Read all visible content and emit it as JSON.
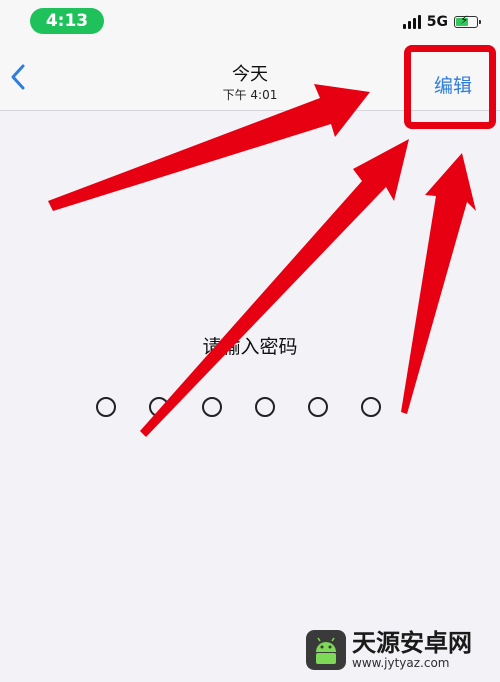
{
  "status_bar": {
    "time": "4:13",
    "network": "5G",
    "time_pill_color": "#1fc15a",
    "battery_color": "#34c759",
    "battery_level": 0.55,
    "icons": [
      "signal-icon",
      "battery-charging-icon"
    ]
  },
  "nav": {
    "back_icon": "chevron-left-icon",
    "title": "今天",
    "subtitle": "下午 4:01",
    "edit_label": "编辑",
    "accent_color": "#2f7ddc"
  },
  "passcode": {
    "prompt": "请输入密码",
    "dot_count": 6,
    "filled": 0
  },
  "annotations": {
    "highlight_color": "#e60012",
    "arrow_color": "#e60012",
    "arrow_count": 3
  },
  "watermark": {
    "title": "天源安卓网",
    "url": "www.jytyaz.com",
    "logo_icon": "android-robot-icon"
  }
}
